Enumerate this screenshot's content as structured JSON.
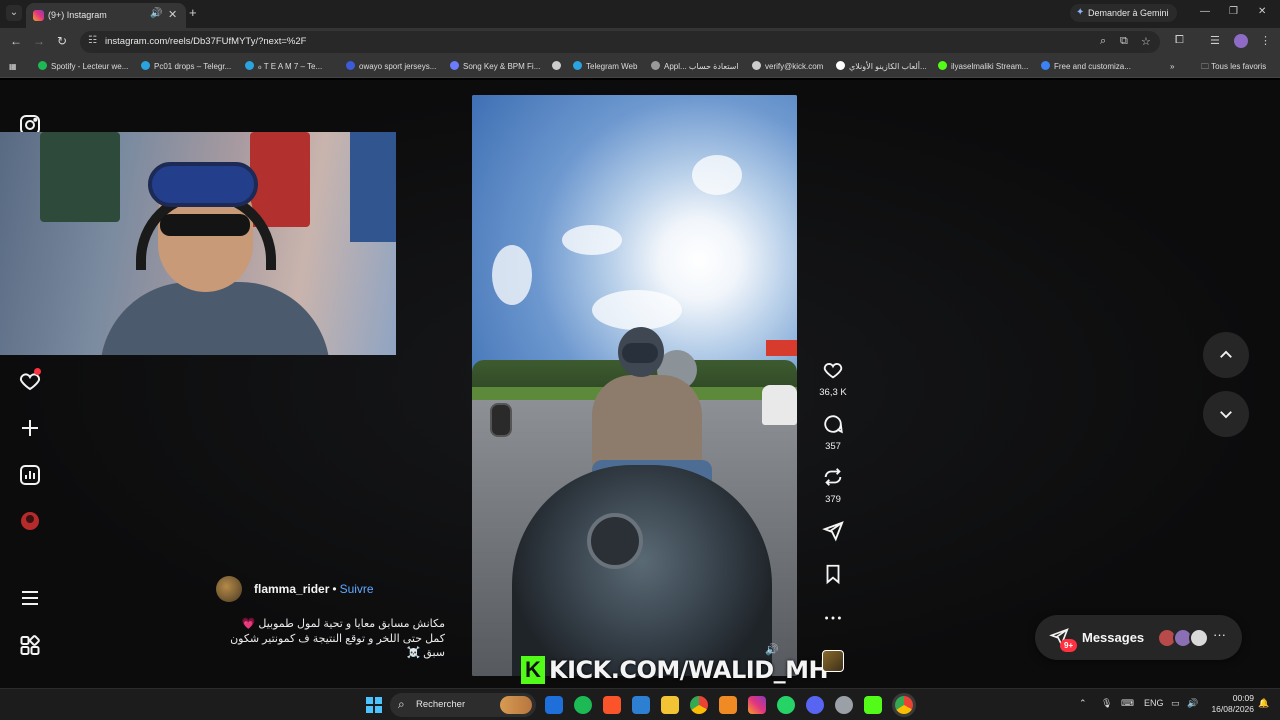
{
  "browser": {
    "tab_title": "(9+) Instagram",
    "gemini_label": "Demander à Gemini",
    "url": "instagram.com/reels/Db37FUfMYTy/?next=%2F",
    "bookmarks": [
      {
        "label": "Spotify - Lecteur we...",
        "color": "#1db954"
      },
      {
        "label": "Pc01 drops – Telegr...",
        "color": "#2aa3df"
      },
      {
        "label": "ℴ T E A M 7 – Te...",
        "color": "#2aa3df"
      },
      {
        "label": "owayo sport jerseys...",
        "color": "#3b5bd9"
      },
      {
        "label": "Song Key & BPM Fi...",
        "color": "#6b7cff"
      },
      {
        "label": "Telegram Web",
        "color": "#2aa3df"
      },
      {
        "label": "Appl... استعادة حساب",
        "color": "#999999"
      },
      {
        "label": "verify@kick.com",
        "color": "#cccccc"
      },
      {
        "label": "ألعاب الكازينو الأونلاي...",
        "color": "#ffffff"
      },
      {
        "label": "ilyaselmaliki Stream...",
        "color": "#53fc18"
      },
      {
        "label": "Free and customiza...",
        "color": "#3b82f6"
      }
    ],
    "all_bookmarks": "Tous les favoris"
  },
  "reel": {
    "author": "flamma_rider",
    "separator": "•",
    "follow": "Suivre",
    "caption_lines": [
      "مكانش مسابق معايا و تحية لمول طموبيل 💗",
      "كمل حتى اللخر و توقع النتيجة ف كمونتير شكون",
      "سبق ☠️"
    ],
    "likes": "36,3 K",
    "comments": "357",
    "reposts": "379",
    "overlay_text": "KICK.COM/WALID_MH",
    "overlay_logo": "K"
  },
  "messages": {
    "label": "Messages",
    "badge": "9+"
  },
  "taskbar": {
    "search_label": "Rechercher",
    "language": "ENG",
    "time": "00:09",
    "date": "16/08/2026"
  }
}
